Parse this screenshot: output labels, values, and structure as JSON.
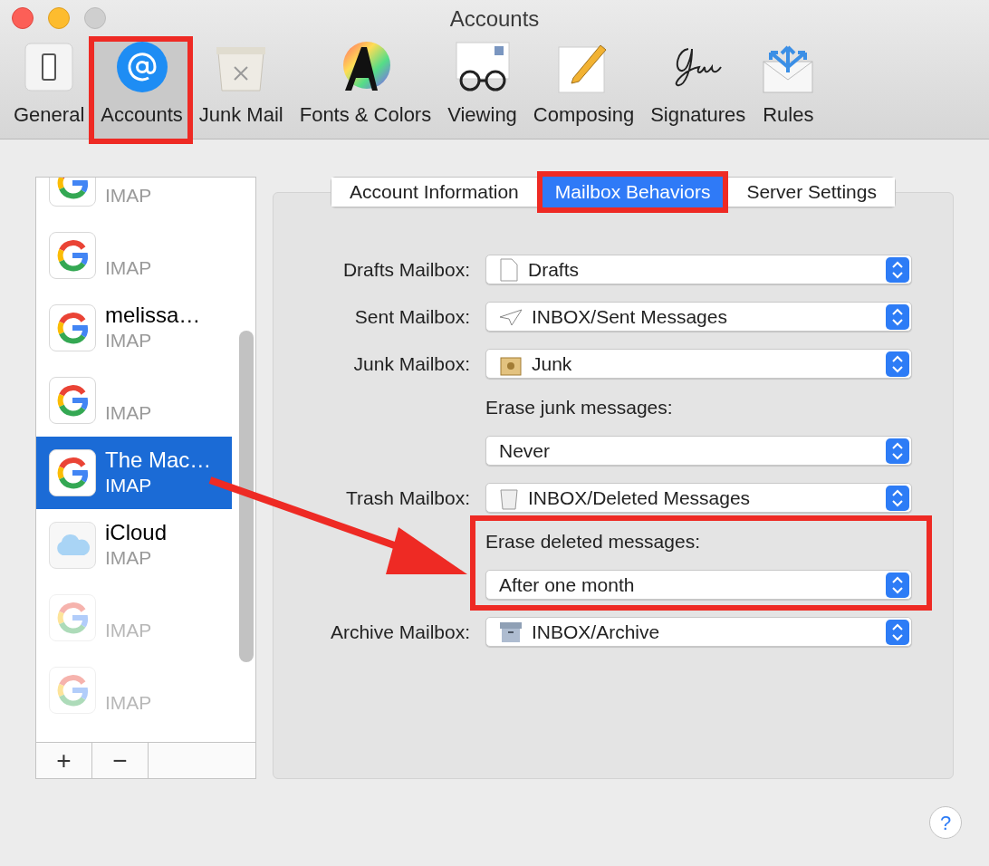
{
  "window": {
    "title": "Accounts"
  },
  "toolbar": [
    {
      "label": "General",
      "selected": false
    },
    {
      "label": "Accounts",
      "selected": true
    },
    {
      "label": "Junk Mail",
      "selected": false
    },
    {
      "label": "Fonts & Colors",
      "selected": false
    },
    {
      "label": "Viewing",
      "selected": false
    },
    {
      "label": "Composing",
      "selected": false
    },
    {
      "label": "Signatures",
      "selected": false
    },
    {
      "label": "Rules",
      "selected": false
    }
  ],
  "accounts": [
    {
      "subtitle": "IMAP",
      "kind": "google",
      "selected": false,
      "disabled": false
    },
    {
      "subtitle": "IMAP",
      "kind": "google",
      "selected": false,
      "disabled": false
    },
    {
      "name": "melissa…",
      "subtitle": "IMAP",
      "kind": "google",
      "selected": false,
      "disabled": false
    },
    {
      "subtitle": "IMAP",
      "kind": "google",
      "selected": false,
      "disabled": false
    },
    {
      "name": "The Mac…",
      "subtitle": "IMAP",
      "kind": "google",
      "selected": true,
      "disabled": false
    },
    {
      "name": "iCloud",
      "subtitle": "IMAP",
      "kind": "icloud",
      "selected": false,
      "disabled": false
    },
    {
      "subtitle": "IMAP",
      "kind": "google",
      "selected": false,
      "disabled": true
    },
    {
      "subtitle": "IMAP",
      "kind": "google",
      "selected": false,
      "disabled": true
    }
  ],
  "list_buttons": [
    "+",
    "−"
  ],
  "tabs": [
    {
      "label": "Account Information",
      "selected": false
    },
    {
      "label": "Mailbox Behaviors",
      "selected": true
    },
    {
      "label": "Server Settings",
      "selected": false
    }
  ],
  "settings": [
    {
      "kind": "mailbox",
      "label": "Drafts Mailbox:",
      "value": "Drafts"
    },
    {
      "kind": "mailbox",
      "label": "Sent Mailbox:",
      "value": "INBOX/Sent Messages"
    },
    {
      "kind": "mailbox",
      "label": "Junk Mailbox:",
      "value": "Junk"
    },
    {
      "kind": "option",
      "label": "Erase junk messages:",
      "value": "Never"
    },
    {
      "kind": "mailbox",
      "label": "Trash Mailbox:",
      "value": "INBOX/Deleted Messages"
    },
    {
      "kind": "option",
      "label": "Erase deleted messages:",
      "value": "After one month"
    },
    {
      "kind": "mailbox",
      "label": "Archive Mailbox:",
      "value": "INBOX/Archive"
    }
  ],
  "help": "?"
}
